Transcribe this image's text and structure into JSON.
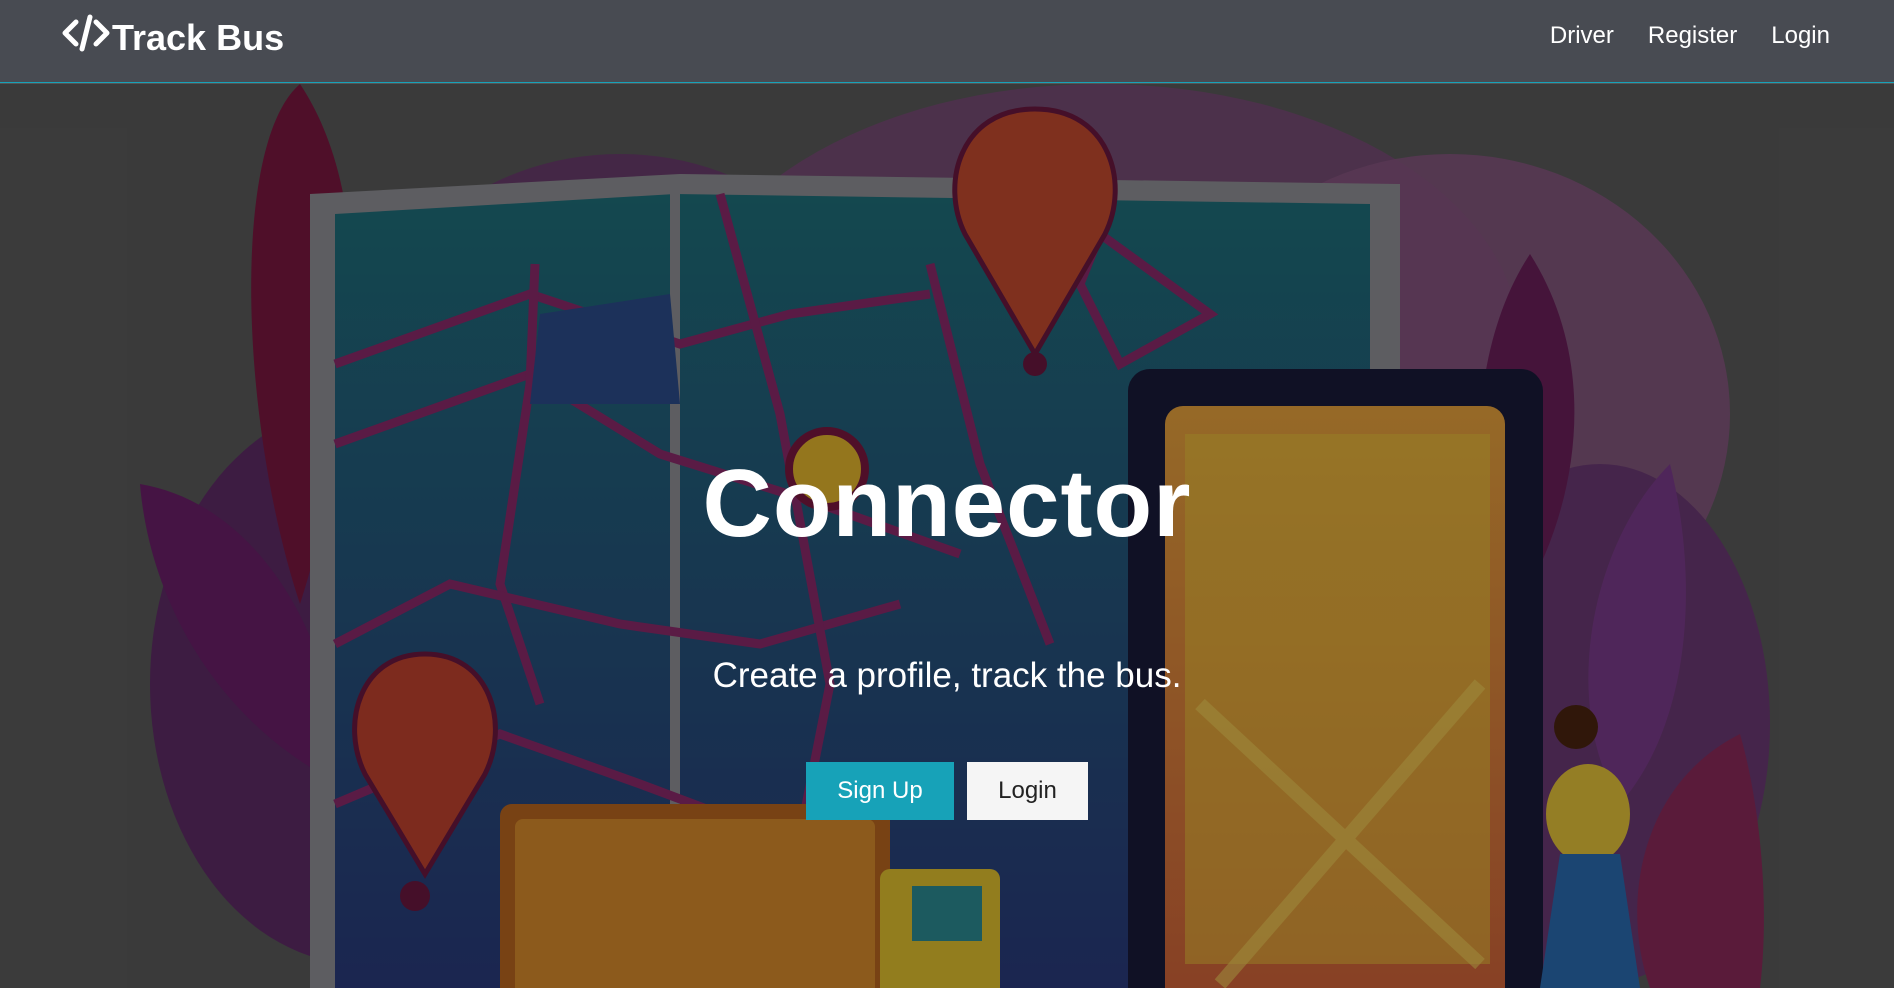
{
  "navbar": {
    "brand": "Track Bus",
    "brand_icon": "code-icon",
    "links": [
      "Driver",
      "Register",
      "Login"
    ]
  },
  "hero": {
    "title": "Connector",
    "subtitle": "Create a profile, track the bus.",
    "signup_label": "Sign Up",
    "login_label": "Login"
  },
  "colors": {
    "navbar": "#484b52",
    "accent": "#17a2b8",
    "secondary_button": "#f5f5f5"
  }
}
